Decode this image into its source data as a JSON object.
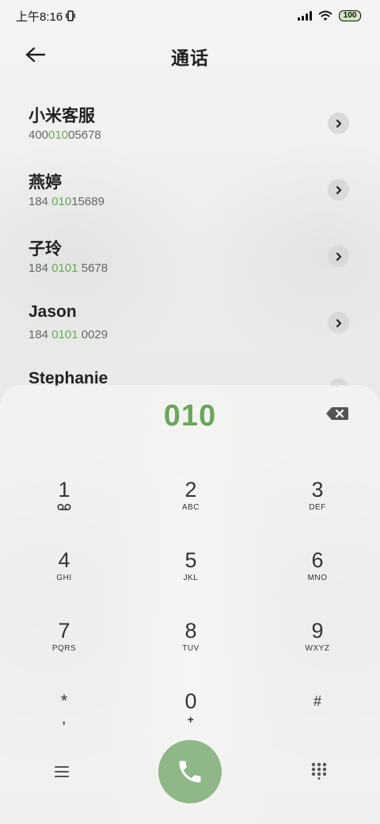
{
  "status_bar": {
    "time": "上午8:16",
    "battery": "100"
  },
  "header": {
    "title": "通话"
  },
  "contacts": [
    {
      "name": "小米客服",
      "number_parts": [
        "400",
        "010",
        "05678"
      ]
    },
    {
      "name": "燕婷",
      "number_parts": [
        "184 ",
        "010",
        "15689"
      ]
    },
    {
      "name": "子玲",
      "number_parts": [
        "184 ",
        "0101",
        " 5678"
      ]
    },
    {
      "name": "Jason",
      "number_parts": [
        "184 ",
        "0101",
        " 0029"
      ]
    },
    {
      "name": "Stephanie",
      "number_parts": [
        "",
        "",
        ""
      ]
    }
  ],
  "dialpad": {
    "dialed_number": "010",
    "keys": [
      {
        "digit": "1",
        "letters": "",
        "sub_icon": "voicemail-icon"
      },
      {
        "digit": "2",
        "letters": "ABC"
      },
      {
        "digit": "3",
        "letters": "DEF"
      },
      {
        "digit": "4",
        "letters": "GHI"
      },
      {
        "digit": "5",
        "letters": "JKL"
      },
      {
        "digit": "6",
        "letters": "MNO"
      },
      {
        "digit": "7",
        "letters": "PQRS"
      },
      {
        "digit": "8",
        "letters": "TUV"
      },
      {
        "digit": "9",
        "letters": "WXYZ"
      },
      {
        "digit": "*",
        "letters": ","
      },
      {
        "digit": "0",
        "letters": "+"
      },
      {
        "digit": "#",
        "letters": ""
      }
    ]
  },
  "colors": {
    "accent_green": "#6aa65b",
    "call_button": "#8fb788"
  }
}
